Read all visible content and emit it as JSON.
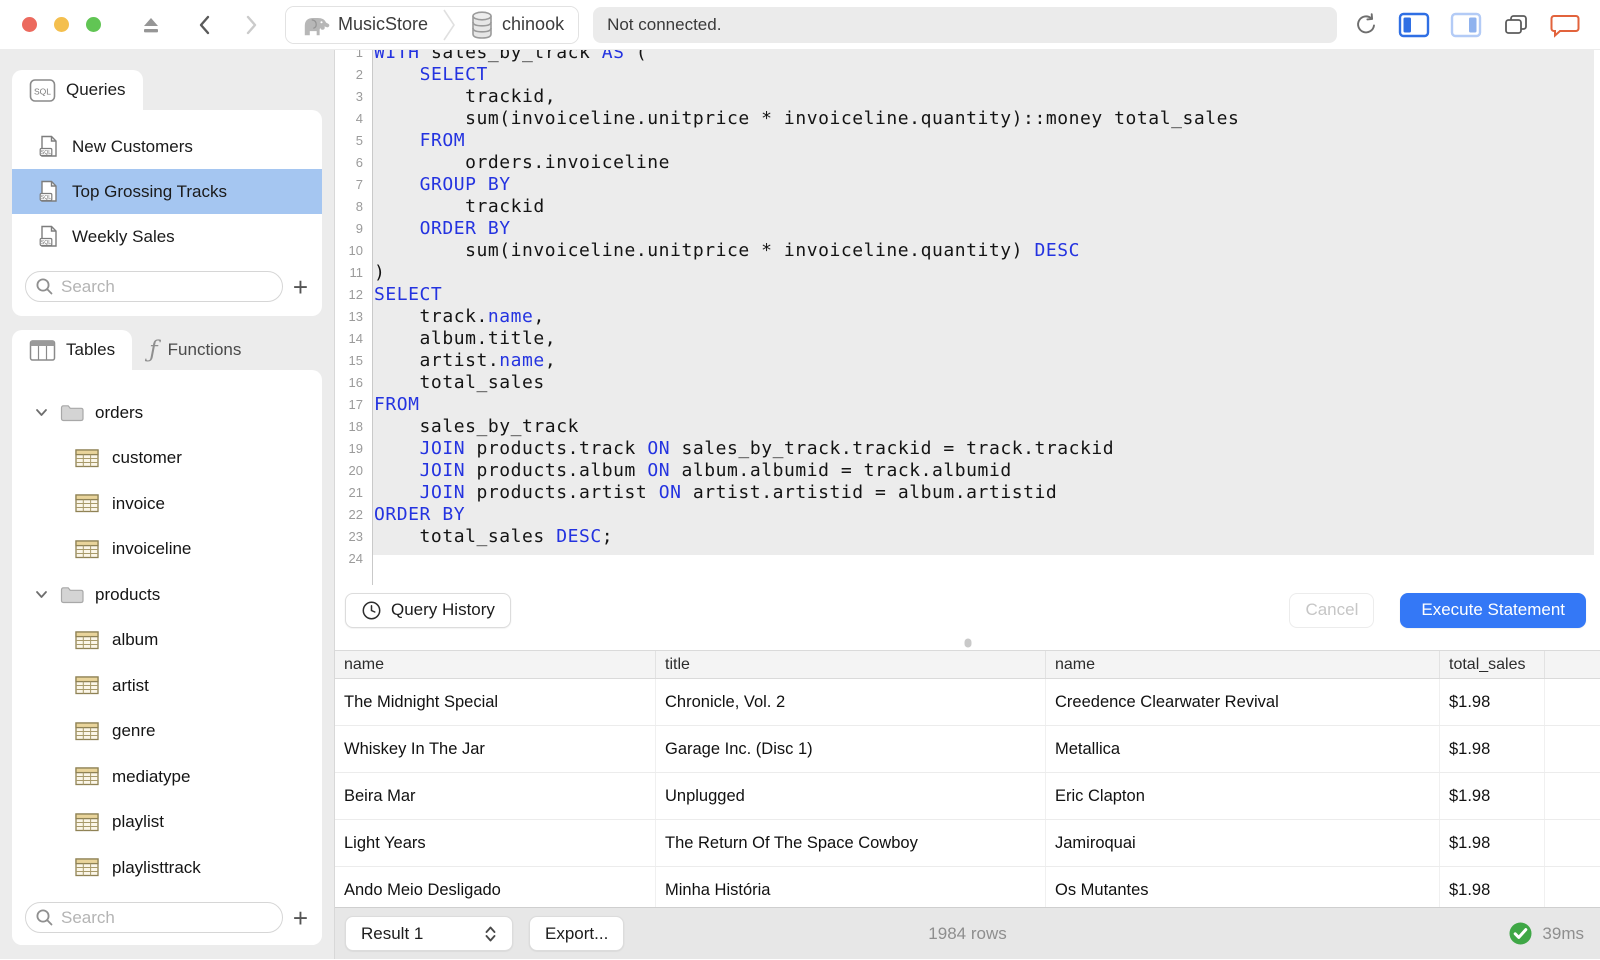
{
  "titlebar": {
    "server": "MusicStore",
    "database": "chinook",
    "status": "Not connected."
  },
  "sidebar": {
    "queries": {
      "tab": "Queries",
      "icon_text": "SQL",
      "items": [
        {
          "label": "New Customers",
          "selected": false
        },
        {
          "label": "Top Grossing Tracks",
          "selected": true
        },
        {
          "label": "Weekly Sales",
          "selected": false
        }
      ],
      "search_placeholder": "Search"
    },
    "tables": {
      "tab_tables": "Tables",
      "tab_functions": "Functions",
      "tree": [
        {
          "type": "folder",
          "label": "orders"
        },
        {
          "type": "table",
          "label": "customer"
        },
        {
          "type": "table",
          "label": "invoice"
        },
        {
          "type": "table",
          "label": "invoiceline"
        },
        {
          "type": "folder",
          "label": "products"
        },
        {
          "type": "table",
          "label": "album"
        },
        {
          "type": "table",
          "label": "artist"
        },
        {
          "type": "table",
          "label": "genre"
        },
        {
          "type": "table",
          "label": "mediatype"
        },
        {
          "type": "table",
          "label": "playlist"
        },
        {
          "type": "table",
          "label": "playlisttrack"
        }
      ],
      "search_placeholder": "Search"
    }
  },
  "editor": {
    "line_count": 24,
    "lines": [
      [
        [
          "WITH",
          1
        ],
        [
          " sales_by_track ",
          0
        ],
        [
          "AS",
          1
        ],
        [
          " (",
          0
        ]
      ],
      [
        [
          "    ",
          0
        ],
        [
          "SELECT",
          1
        ]
      ],
      [
        [
          "        trackid,",
          0
        ]
      ],
      [
        [
          "        sum(invoiceline.unitprice * invoiceline.quantity)::money total_sales",
          0
        ]
      ],
      [
        [
          "    ",
          0
        ],
        [
          "FROM",
          1
        ]
      ],
      [
        [
          "        orders.invoiceline",
          0
        ]
      ],
      [
        [
          "    ",
          0
        ],
        [
          "GROUP BY",
          1
        ]
      ],
      [
        [
          "        trackid",
          0
        ]
      ],
      [
        [
          "    ",
          0
        ],
        [
          "ORDER BY",
          1
        ]
      ],
      [
        [
          "        sum(invoiceline.unitprice * invoiceline.quantity) ",
          0
        ],
        [
          "DESC",
          1
        ]
      ],
      [
        [
          ")",
          0
        ]
      ],
      [
        [
          "SELECT",
          1
        ]
      ],
      [
        [
          "    track.",
          0
        ],
        [
          "name",
          1
        ],
        [
          ",",
          0
        ]
      ],
      [
        [
          "    album.title,",
          0
        ]
      ],
      [
        [
          "    artist.",
          0
        ],
        [
          "name",
          1
        ],
        [
          ",",
          0
        ]
      ],
      [
        [
          "    total_sales",
          0
        ]
      ],
      [
        [
          "FROM",
          1
        ]
      ],
      [
        [
          "    sales_by_track",
          0
        ]
      ],
      [
        [
          "    ",
          0
        ],
        [
          "JOIN",
          1
        ],
        [
          " products.track ",
          0
        ],
        [
          "ON",
          1
        ],
        [
          " sales_by_track.trackid = track.trackid",
          0
        ]
      ],
      [
        [
          "    ",
          0
        ],
        [
          "JOIN",
          1
        ],
        [
          " products.album ",
          0
        ],
        [
          "ON",
          1
        ],
        [
          " album.albumid = track.albumid",
          0
        ]
      ],
      [
        [
          "    ",
          0
        ],
        [
          "JOIN",
          1
        ],
        [
          " products.artist ",
          0
        ],
        [
          "ON",
          1
        ],
        [
          " artist.artistid = album.artistid",
          0
        ]
      ],
      [
        [
          "ORDER BY",
          1
        ]
      ],
      [
        [
          "    total_sales ",
          0
        ],
        [
          "DESC",
          1
        ],
        [
          ";",
          0
        ]
      ],
      []
    ]
  },
  "actions": {
    "query_history": "Query History",
    "cancel": "Cancel",
    "execute": "Execute Statement"
  },
  "results": {
    "columns": [
      "name",
      "title",
      "name",
      "total_sales"
    ],
    "rows": [
      [
        "The Midnight Special",
        "Chronicle, Vol. 2",
        "Creedence Clearwater Revival",
        "$1.98"
      ],
      [
        "Whiskey In The Jar",
        "Garage Inc. (Disc 1)",
        "Metallica",
        "$1.98"
      ],
      [
        "Beira Mar",
        "Unplugged",
        "Eric Clapton",
        "$1.98"
      ],
      [
        "Light Years",
        "The Return Of The Space Cowboy",
        "Jamiroquai",
        "$1.98"
      ],
      [
        "Ando Meio Desligado",
        "Minha História",
        "Os Mutantes",
        "$1.98"
      ]
    ]
  },
  "statusbar": {
    "result_selector": "Result 1",
    "export": "Export...",
    "row_count": "1984 rows",
    "duration": "39ms"
  },
  "colors": {
    "keyword_blue": "#2433e0",
    "selection_blue": "#a5c6f1",
    "accent_blue": "#3478f6",
    "success_green": "#3fa746",
    "chat_orange": "#e2633c"
  }
}
